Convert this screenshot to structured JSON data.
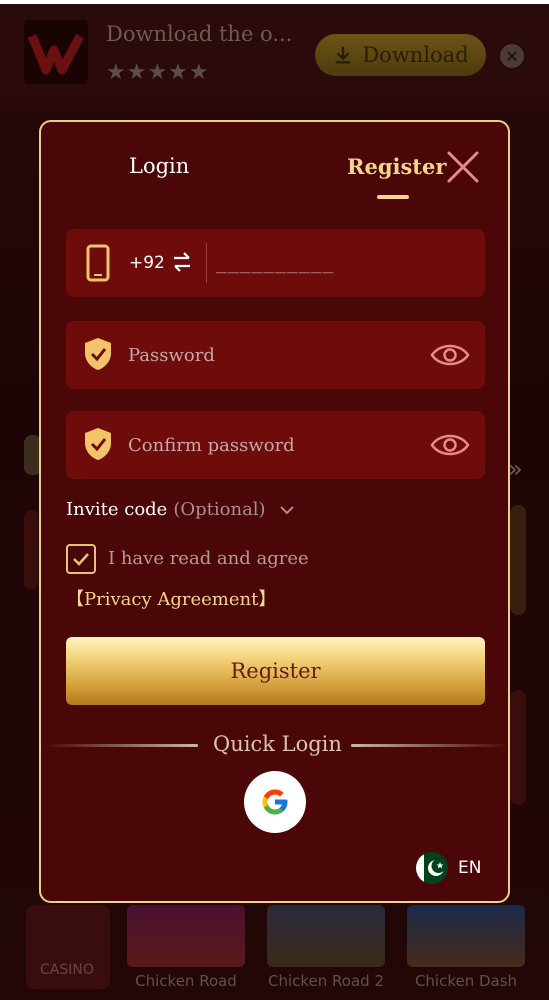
{
  "banner": {
    "text": "Download the o...",
    "rating_stars": "★★★★★",
    "download_label": "Download",
    "close_glyph": "✕"
  },
  "background": {
    "category": "CASINO",
    "games": [
      "Chicken Road",
      "Chicken Road 2",
      "Chicken Dash"
    ],
    "arrows": "»"
  },
  "modal": {
    "tabs": {
      "login": "Login",
      "register": "Register"
    },
    "phone": {
      "country_code": "+92",
      "placeholder": "__________"
    },
    "password": {
      "placeholder": "Password"
    },
    "confirm_password": {
      "placeholder": "Confirm password"
    },
    "invite": {
      "label": "Invite code",
      "optional": "(Optional)"
    },
    "agreement": {
      "checked": true,
      "text": "I have read and agree",
      "link": "【Privacy Agreement】"
    },
    "register_button": "Register",
    "quick_login": "Quick Login",
    "language": {
      "code": "EN"
    }
  },
  "colors": {
    "modal_bg": "#4b0707",
    "field_bg": "#6e0c0c",
    "gold": "#f3d58b",
    "border": "#e9cf8a"
  },
  "icons": [
    "phone-icon",
    "swap-icon",
    "shield-icon",
    "eye-icon",
    "close-icon",
    "chevron-down-icon",
    "check-icon",
    "google-icon",
    "pakistan-flag-icon",
    "download-icon"
  ]
}
